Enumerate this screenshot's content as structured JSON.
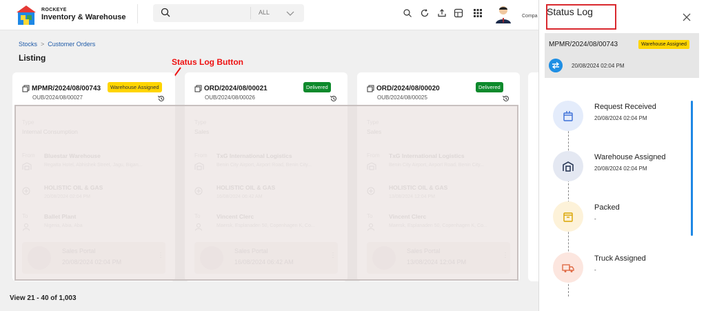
{
  "app": {
    "brand_small": "ROCKEYE",
    "brand_name": "Inventory & Warehouse",
    "user_company": "Compa"
  },
  "search": {
    "placeholder": "",
    "scope": "ALL"
  },
  "toolbar_icons": [
    "search-icon",
    "refresh-icon",
    "upload-icon",
    "table-icon",
    "apps-grid-icon"
  ],
  "breadcrumb": [
    "Stocks",
    "Customer Orders"
  ],
  "page_title": "Listing",
  "annotation": "Status Log Button",
  "cards": [
    {
      "id": "MPMR/2024/08/00743",
      "sub_id": "OUB/2024/08/00027",
      "status": "Warehouse Assigned",
      "status_color": "#ffd500",
      "type_label": "Type",
      "type": "Internal Consumption",
      "from_label": "From",
      "from_name": "Bluestar Warehouse",
      "from_addr": "Regatta Hotel, Abhishek Street, Jagu, Bigan...",
      "company": "HOLISTIC OIL & GAS",
      "company_date": "20/08/2024 02:04 PM",
      "to_label": "To",
      "to_name": "Ballet Plant",
      "to_addr": "Nigeria, Abia, Aba",
      "portal": "Sales Portal",
      "portal_date": "20/08/2024 02:04 PM"
    },
    {
      "id": "ORD/2024/08/00021",
      "sub_id": "OUB/2024/08/00026",
      "status": "Delivered",
      "status_color": "#0d8a2c",
      "type_label": "Type",
      "type": "Sales",
      "from_label": "From",
      "from_name": "TxG International Logistics",
      "from_addr": "Benin City Airport, Airport Road, Benin City...",
      "company": "HOLISTIC OIL & GAS",
      "company_date": "16/08/2024 06:42 AM",
      "to_label": "To",
      "to_name": "Vincent Clerc",
      "to_addr": "Maersk, Esplanaden 50, Copenhagen K, Co...",
      "portal": "Sales Portal",
      "portal_date": "16/08/2024 06:42 AM"
    },
    {
      "id": "ORD/2024/08/00020",
      "sub_id": "OUB/2024/08/00025",
      "status": "Delivered",
      "status_color": "#0d8a2c",
      "type_label": "Type",
      "type": "Sales",
      "from_label": "From",
      "from_name": "TxG International Logistics",
      "from_addr": "Benin City Airport, Airport Road, Benin City...",
      "company": "HOLISTIC OIL & GAS",
      "company_date": "13/08/2024 12:04 PM",
      "to_label": "To",
      "to_name": "Vincent Clerc",
      "to_addr": "Maersk, Esplanaden 50, Copenhagen K, Co...",
      "portal": "Sales Portal",
      "portal_date": "13/08/2024 12:04 PM"
    }
  ],
  "pagination": "View 21 - 40 of 1,003",
  "status_log": {
    "title": "Status Log",
    "order_id": "MPMR/2024/08/00743",
    "badge": "Warehouse Assigned",
    "date": "20/08/2024 02:04 PM",
    "steps": [
      {
        "label": "Request Received",
        "value": "20/08/2024 02:04 PM",
        "icon": "request-box-icon",
        "color": "#e4ecfb"
      },
      {
        "label": "Warehouse Assigned",
        "value": "20/08/2024 02:04 PM",
        "icon": "warehouse-icon",
        "color": "#e4e8f2"
      },
      {
        "label": "Packed",
        "value": "-",
        "icon": "packed-box-icon",
        "color": "#fdf2d9"
      },
      {
        "label": "Truck Assigned",
        "value": "-",
        "icon": "truck-icon",
        "color": "#fce6df"
      }
    ]
  }
}
